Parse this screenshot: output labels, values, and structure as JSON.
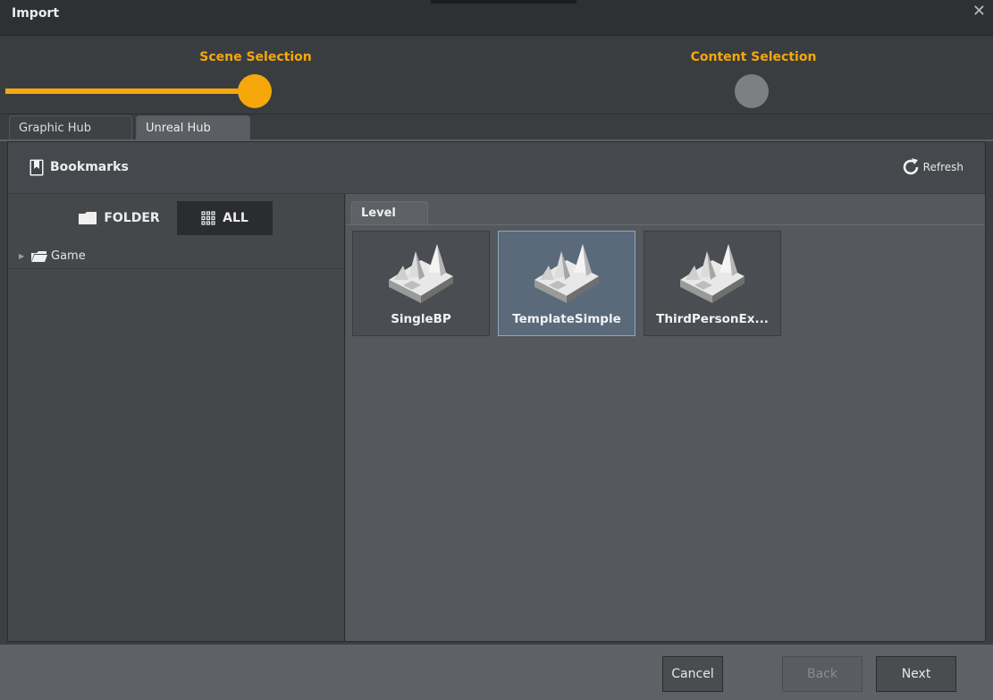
{
  "window": {
    "title": "Import",
    "close_glyph": "✕"
  },
  "wizard": {
    "accent": "#f5a70b",
    "steps": [
      {
        "label": "Scene Selection",
        "state": "current"
      },
      {
        "label": "Content Selection",
        "state": "pending"
      }
    ]
  },
  "hub_tabs": [
    {
      "label": "Graphic Hub",
      "active": false
    },
    {
      "label": "Unreal Hub",
      "active": true
    }
  ],
  "bookmarks": {
    "label": "Bookmarks",
    "icon": "bookmark-icon"
  },
  "refresh": {
    "label": "Refresh",
    "icon": "refresh-icon"
  },
  "view_toggle": [
    {
      "label": "FOLDER",
      "icon": "folder-icon",
      "selected": false
    },
    {
      "label": "ALL",
      "icon": "grid-icon",
      "selected": true
    }
  ],
  "tree": [
    {
      "label": "Game",
      "icon": "folder-icon",
      "expanded": false
    }
  ],
  "content_tab": {
    "label": "Level"
  },
  "levels": [
    {
      "label": "SingleBP",
      "selected": false,
      "icon": "level-icon"
    },
    {
      "label": "TemplateSimple",
      "selected": true,
      "icon": "level-icon"
    },
    {
      "label": "ThirdPersonEx...",
      "selected": false,
      "icon": "level-icon"
    }
  ],
  "footer": {
    "cancel": "Cancel",
    "back": "Back",
    "next": "Next",
    "back_enabled": false
  }
}
